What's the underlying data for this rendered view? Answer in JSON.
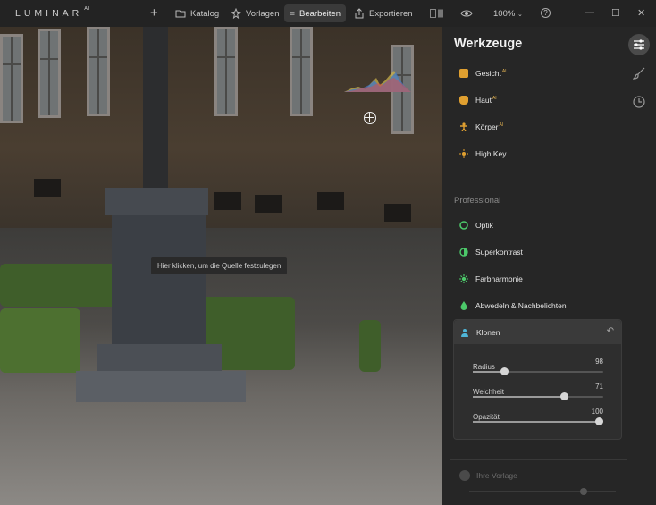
{
  "app": {
    "logo": "LUMINAR",
    "logo_sup": "AI"
  },
  "topbar": {
    "add_label": "+",
    "tabs": [
      {
        "label": "Katalog",
        "icon": "folder-icon"
      },
      {
        "label": "Vorlagen",
        "icon": "presets-icon"
      },
      {
        "label": "Bearbeiten",
        "icon": "sliders-icon",
        "active": true
      },
      {
        "label": "Exportieren",
        "icon": "export-icon"
      }
    ],
    "zoom": "100%",
    "help": "?",
    "window_controls": {
      "minimize": "—",
      "maximize": "☐",
      "close": "✕"
    }
  },
  "canvas": {
    "tooltip": "Hier klicken, um die Quelle festzulegen"
  },
  "panel": {
    "title": "Werkzeuge",
    "ai_badge": "AI",
    "tools_top": [
      {
        "label": "Gesicht",
        "ai": true,
        "icon": "face-icon",
        "color": "#e0a030"
      },
      {
        "label": "Haut",
        "ai": true,
        "icon": "skin-icon",
        "color": "#e0a030"
      },
      {
        "label": "Körper",
        "ai": true,
        "icon": "body-icon",
        "color": "#e0a030"
      },
      {
        "label": "High Key",
        "ai": false,
        "icon": "highkey-icon",
        "color": "#e0a030"
      }
    ],
    "section_professional": "Professional",
    "tools_pro": [
      {
        "label": "Optik",
        "icon": "optics-icon",
        "color": "#4cc96a"
      },
      {
        "label": "Superkontrast",
        "icon": "contrast-icon",
        "color": "#4cc96a"
      },
      {
        "label": "Farbharmonie",
        "icon": "harmony-icon",
        "color": "#4cc96a"
      },
      {
        "label": "Abwedeln & Nachbelichten",
        "icon": "dodge-icon",
        "color": "#4cc96a"
      }
    ],
    "clone": {
      "label": "Klonen",
      "icon": "clone-icon",
      "color": "#4fb6d8",
      "sliders": [
        {
          "label": "Radius",
          "value": "98",
          "fraction": 0.24
        },
        {
          "label": "Weichheit",
          "value": "71",
          "fraction": 0.7
        },
        {
          "label": "Opazität",
          "value": "100",
          "fraction": 0.97
        }
      ]
    },
    "preset": {
      "label": "Ihre Vorlage"
    }
  }
}
